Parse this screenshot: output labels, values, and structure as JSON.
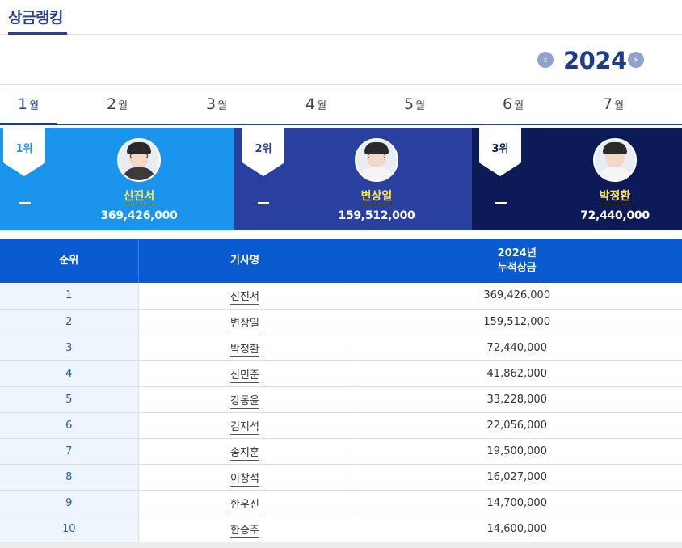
{
  "header": {
    "title": "상금랭킹"
  },
  "year_nav": {
    "year": "2024",
    "prev_icon": "chevron-left-icon",
    "next_icon": "chevron-right-icon",
    "prev_symbol": "‹",
    "next_symbol": "›"
  },
  "months": [
    {
      "num": "1",
      "unit": "월",
      "active": true
    },
    {
      "num": "2",
      "unit": "월"
    },
    {
      "num": "3",
      "unit": "월"
    },
    {
      "num": "4",
      "unit": "월"
    },
    {
      "num": "5",
      "unit": "월"
    },
    {
      "num": "6",
      "unit": "월"
    },
    {
      "num": "7",
      "unit": "월"
    }
  ],
  "podium": [
    {
      "rank": "1위",
      "name": "신진서",
      "prize": "369,426,000",
      "change": "–",
      "color": "#1b94ee"
    },
    {
      "rank": "2위",
      "name": "변상일",
      "prize": "159,512,000",
      "change": "–",
      "color": "#2940a0"
    },
    {
      "rank": "3위",
      "name": "박정환",
      "prize": "72,440,000",
      "change": "–",
      "color": "#0d1a58"
    }
  ],
  "table": {
    "headers": {
      "rank": "순위",
      "player": "기사명",
      "prize_line1": "2024년",
      "prize_line2": "누적상금"
    },
    "rows": [
      {
        "rank": "1",
        "name": "신진서",
        "prize": "369,426,000"
      },
      {
        "rank": "2",
        "name": "변상일",
        "prize": "159,512,000"
      },
      {
        "rank": "3",
        "name": "박정환",
        "prize": "72,440,000"
      },
      {
        "rank": "4",
        "name": "신민준",
        "prize": "41,862,000"
      },
      {
        "rank": "5",
        "name": "강동윤",
        "prize": "33,228,000"
      },
      {
        "rank": "6",
        "name": "김지석",
        "prize": "22,056,000"
      },
      {
        "rank": "7",
        "name": "송지훈",
        "prize": "19,500,000"
      },
      {
        "rank": "8",
        "name": "이창석",
        "prize": "16,027,000"
      },
      {
        "rank": "9",
        "name": "한우진",
        "prize": "14,700,000"
      },
      {
        "rank": "10",
        "name": "한승주",
        "prize": "14,600,000"
      }
    ]
  },
  "colors": {
    "accent": "#1d3c8b",
    "table_header": "#0b5bd0",
    "name_highlight": "#ffe64b"
  }
}
